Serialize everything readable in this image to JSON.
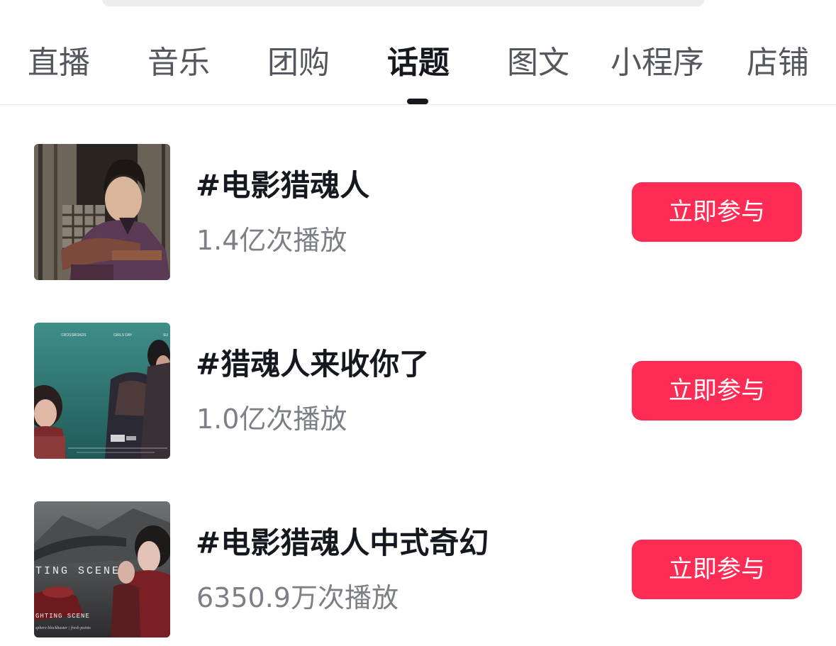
{
  "tabs": [
    {
      "label": "直播"
    },
    {
      "label": "音乐"
    },
    {
      "label": "团购"
    },
    {
      "label": "话题",
      "active": true
    },
    {
      "label": "图文"
    },
    {
      "label": "小程序"
    },
    {
      "label": "店铺"
    }
  ],
  "topics": [
    {
      "title": "#电影猎魂人",
      "plays": "1.4亿次播放",
      "action": "立即参与"
    },
    {
      "title": "#猎魂人来收你了",
      "plays": "1.0亿次播放",
      "action": "立即参与"
    },
    {
      "title": "#电影猎魂人中式奇幻",
      "plays": "6350.9万次播放",
      "action": "立即参与"
    }
  ],
  "thumbnails": {
    "second": {
      "captions": [
        "CROSSROADS",
        "GIRLS DAY",
        "SU"
      ]
    },
    "third": {
      "captions": [
        "TING  SCENE",
        "GHTING SCENE",
        "sphere blockbuster | fresh points"
      ]
    }
  },
  "colors": {
    "accent": "#fe2c55",
    "active_tab": "#16181f",
    "inactive_tab": "#55575e",
    "secondary_text": "#7d7f86"
  }
}
